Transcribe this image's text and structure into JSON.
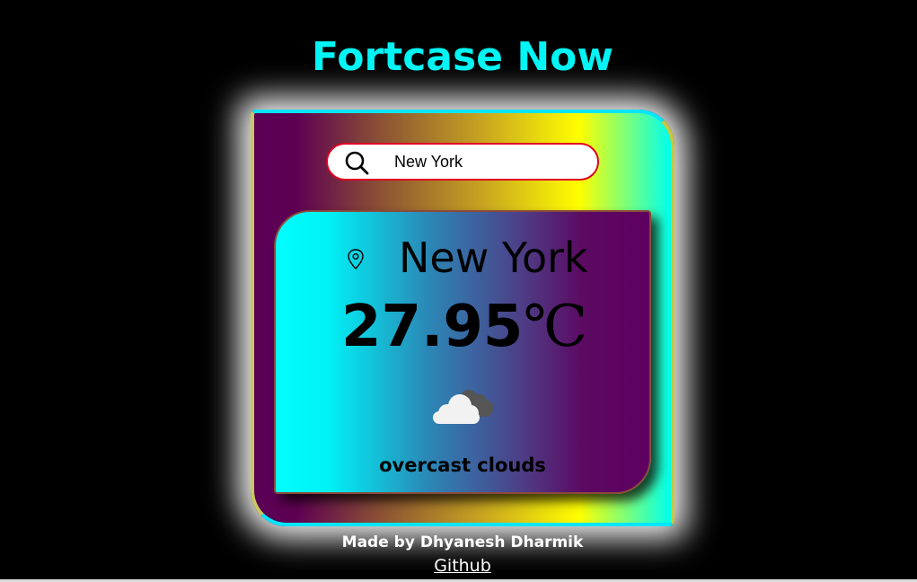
{
  "header": {
    "title": "Fortcase Now"
  },
  "search": {
    "value": "New York",
    "icon": "search-icon"
  },
  "weather": {
    "city": "New York",
    "temperature": "27.95",
    "unit": "℃",
    "description": "overcast clouds",
    "location_icon": "location-pin-icon",
    "condition_icon": "cloud-icon"
  },
  "footer": {
    "credit": "Made by Dhyanesh Dharmik",
    "link_label": "Github"
  },
  "colors": {
    "background": "#000000",
    "title": "#00f5f5",
    "search_border": "#e00020"
  }
}
